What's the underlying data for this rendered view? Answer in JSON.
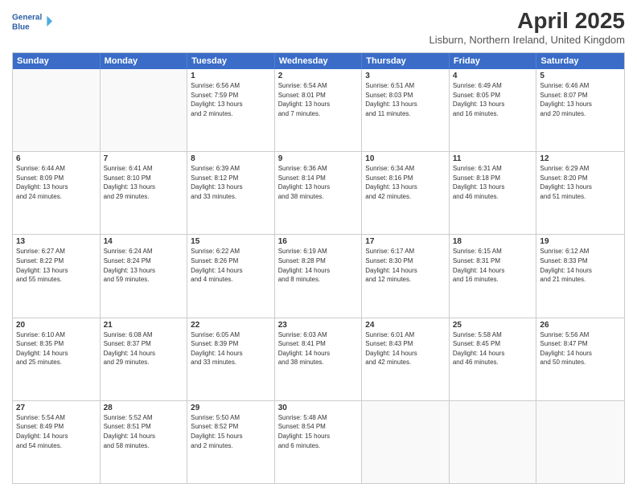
{
  "header": {
    "logo_line1": "General",
    "logo_line2": "Blue",
    "main_title": "April 2025",
    "subtitle": "Lisburn, Northern Ireland, United Kingdom"
  },
  "calendar": {
    "days_of_week": [
      "Sunday",
      "Monday",
      "Tuesday",
      "Wednesday",
      "Thursday",
      "Friday",
      "Saturday"
    ],
    "rows": [
      [
        {
          "day": "",
          "empty": true
        },
        {
          "day": "",
          "empty": true
        },
        {
          "day": "1",
          "lines": [
            "Sunrise: 6:56 AM",
            "Sunset: 7:59 PM",
            "Daylight: 13 hours",
            "and 2 minutes."
          ]
        },
        {
          "day": "2",
          "lines": [
            "Sunrise: 6:54 AM",
            "Sunset: 8:01 PM",
            "Daylight: 13 hours",
            "and 7 minutes."
          ]
        },
        {
          "day": "3",
          "lines": [
            "Sunrise: 6:51 AM",
            "Sunset: 8:03 PM",
            "Daylight: 13 hours",
            "and 11 minutes."
          ]
        },
        {
          "day": "4",
          "lines": [
            "Sunrise: 6:49 AM",
            "Sunset: 8:05 PM",
            "Daylight: 13 hours",
            "and 16 minutes."
          ]
        },
        {
          "day": "5",
          "lines": [
            "Sunrise: 6:46 AM",
            "Sunset: 8:07 PM",
            "Daylight: 13 hours",
            "and 20 minutes."
          ]
        }
      ],
      [
        {
          "day": "6",
          "lines": [
            "Sunrise: 6:44 AM",
            "Sunset: 8:09 PM",
            "Daylight: 13 hours",
            "and 24 minutes."
          ]
        },
        {
          "day": "7",
          "lines": [
            "Sunrise: 6:41 AM",
            "Sunset: 8:10 PM",
            "Daylight: 13 hours",
            "and 29 minutes."
          ]
        },
        {
          "day": "8",
          "lines": [
            "Sunrise: 6:39 AM",
            "Sunset: 8:12 PM",
            "Daylight: 13 hours",
            "and 33 minutes."
          ]
        },
        {
          "day": "9",
          "lines": [
            "Sunrise: 6:36 AM",
            "Sunset: 8:14 PM",
            "Daylight: 13 hours",
            "and 38 minutes."
          ]
        },
        {
          "day": "10",
          "lines": [
            "Sunrise: 6:34 AM",
            "Sunset: 8:16 PM",
            "Daylight: 13 hours",
            "and 42 minutes."
          ]
        },
        {
          "day": "11",
          "lines": [
            "Sunrise: 6:31 AM",
            "Sunset: 8:18 PM",
            "Daylight: 13 hours",
            "and 46 minutes."
          ]
        },
        {
          "day": "12",
          "lines": [
            "Sunrise: 6:29 AM",
            "Sunset: 8:20 PM",
            "Daylight: 13 hours",
            "and 51 minutes."
          ]
        }
      ],
      [
        {
          "day": "13",
          "lines": [
            "Sunrise: 6:27 AM",
            "Sunset: 8:22 PM",
            "Daylight: 13 hours",
            "and 55 minutes."
          ]
        },
        {
          "day": "14",
          "lines": [
            "Sunrise: 6:24 AM",
            "Sunset: 8:24 PM",
            "Daylight: 13 hours",
            "and 59 minutes."
          ]
        },
        {
          "day": "15",
          "lines": [
            "Sunrise: 6:22 AM",
            "Sunset: 8:26 PM",
            "Daylight: 14 hours",
            "and 4 minutes."
          ]
        },
        {
          "day": "16",
          "lines": [
            "Sunrise: 6:19 AM",
            "Sunset: 8:28 PM",
            "Daylight: 14 hours",
            "and 8 minutes."
          ]
        },
        {
          "day": "17",
          "lines": [
            "Sunrise: 6:17 AM",
            "Sunset: 8:30 PM",
            "Daylight: 14 hours",
            "and 12 minutes."
          ]
        },
        {
          "day": "18",
          "lines": [
            "Sunrise: 6:15 AM",
            "Sunset: 8:31 PM",
            "Daylight: 14 hours",
            "and 16 minutes."
          ]
        },
        {
          "day": "19",
          "lines": [
            "Sunrise: 6:12 AM",
            "Sunset: 8:33 PM",
            "Daylight: 14 hours",
            "and 21 minutes."
          ]
        }
      ],
      [
        {
          "day": "20",
          "lines": [
            "Sunrise: 6:10 AM",
            "Sunset: 8:35 PM",
            "Daylight: 14 hours",
            "and 25 minutes."
          ]
        },
        {
          "day": "21",
          "lines": [
            "Sunrise: 6:08 AM",
            "Sunset: 8:37 PM",
            "Daylight: 14 hours",
            "and 29 minutes."
          ]
        },
        {
          "day": "22",
          "lines": [
            "Sunrise: 6:05 AM",
            "Sunset: 8:39 PM",
            "Daylight: 14 hours",
            "and 33 minutes."
          ]
        },
        {
          "day": "23",
          "lines": [
            "Sunrise: 6:03 AM",
            "Sunset: 8:41 PM",
            "Daylight: 14 hours",
            "and 38 minutes."
          ]
        },
        {
          "day": "24",
          "lines": [
            "Sunrise: 6:01 AM",
            "Sunset: 8:43 PM",
            "Daylight: 14 hours",
            "and 42 minutes."
          ]
        },
        {
          "day": "25",
          "lines": [
            "Sunrise: 5:58 AM",
            "Sunset: 8:45 PM",
            "Daylight: 14 hours",
            "and 46 minutes."
          ]
        },
        {
          "day": "26",
          "lines": [
            "Sunrise: 5:56 AM",
            "Sunset: 8:47 PM",
            "Daylight: 14 hours",
            "and 50 minutes."
          ]
        }
      ],
      [
        {
          "day": "27",
          "lines": [
            "Sunrise: 5:54 AM",
            "Sunset: 8:49 PM",
            "Daylight: 14 hours",
            "and 54 minutes."
          ]
        },
        {
          "day": "28",
          "lines": [
            "Sunrise: 5:52 AM",
            "Sunset: 8:51 PM",
            "Daylight: 14 hours",
            "and 58 minutes."
          ]
        },
        {
          "day": "29",
          "lines": [
            "Sunrise: 5:50 AM",
            "Sunset: 8:52 PM",
            "Daylight: 15 hours",
            "and 2 minutes."
          ]
        },
        {
          "day": "30",
          "lines": [
            "Sunrise: 5:48 AM",
            "Sunset: 8:54 PM",
            "Daylight: 15 hours",
            "and 6 minutes."
          ]
        },
        {
          "day": "",
          "empty": true
        },
        {
          "day": "",
          "empty": true
        },
        {
          "day": "",
          "empty": true
        }
      ]
    ]
  }
}
